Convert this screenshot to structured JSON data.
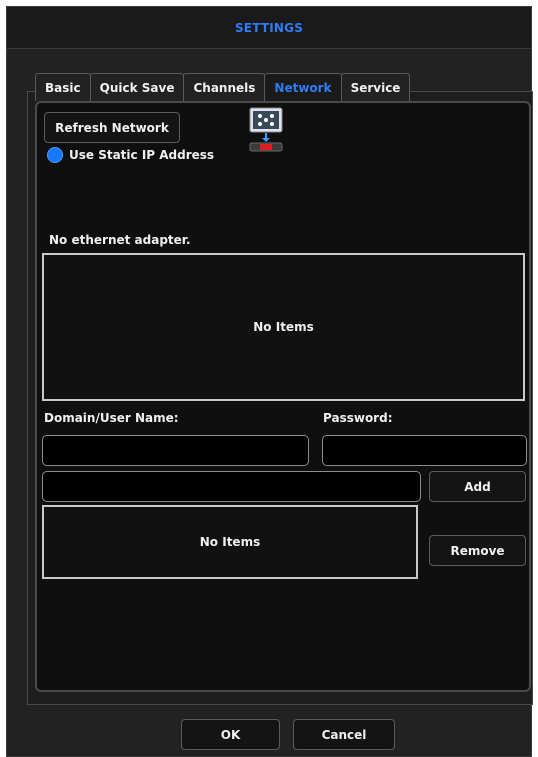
{
  "window": {
    "title": "SETTINGS"
  },
  "tabs": [
    {
      "label": "Basic",
      "active": false
    },
    {
      "label": "Quick Save",
      "active": false
    },
    {
      "label": "Channels",
      "active": false
    },
    {
      "label": "Network",
      "active": true
    },
    {
      "label": "Service",
      "active": false
    }
  ],
  "network": {
    "refresh_label": "Refresh Network",
    "static_ip_label": "Use Static IP Address",
    "static_ip_selected": true,
    "network_icon": "network-adapter-icon",
    "adapter_status": "No ethernet adapter.",
    "adapter_list_empty": "No Items",
    "domain_user_label": "Domain/User Name:",
    "domain_user_value": "",
    "password_label": "Password:",
    "password_value": "",
    "share_path_value": "",
    "add_label": "Add",
    "share_list_empty": "No Items",
    "remove_label": "Remove"
  },
  "footer": {
    "ok_label": "OK",
    "cancel_label": "Cancel"
  },
  "colors": {
    "accent": "#2f7cf6",
    "radio": "#1677ff",
    "background": "#222222",
    "content_bg": "#0f0f0f"
  }
}
